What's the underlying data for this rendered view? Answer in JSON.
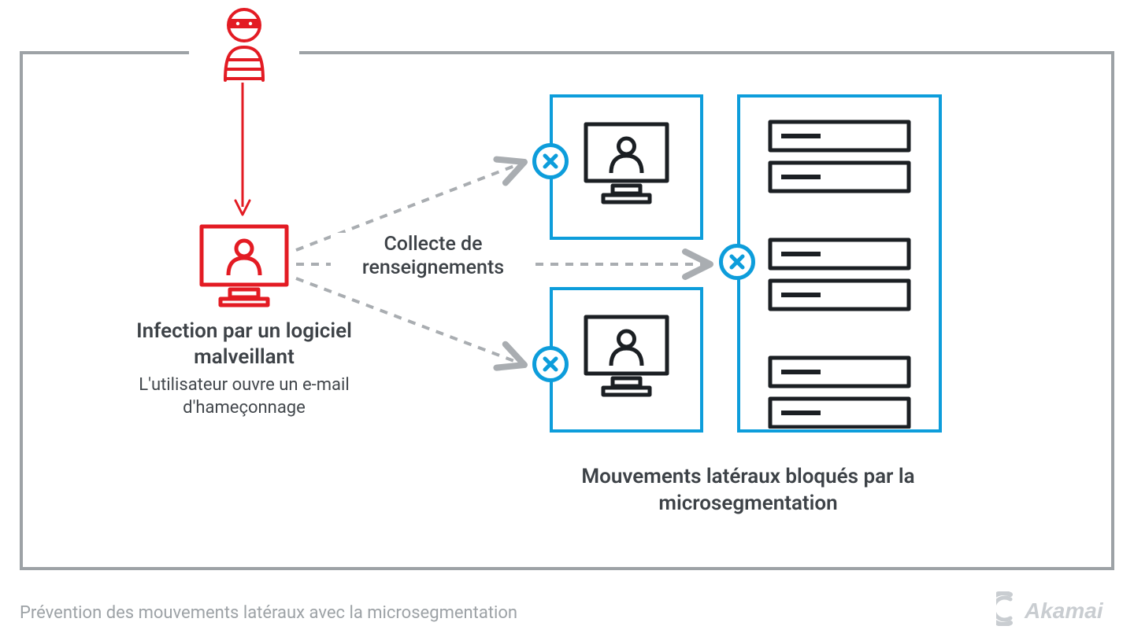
{
  "infection": {
    "title": "Infection par un logiciel malveillant",
    "subtitle": "L'utilisateur ouvre un e-mail d'hameçonnage"
  },
  "collect_label": "Collecte de renseignements",
  "blocked_label": "Mouvements latéraux bloqués par la microsegmentation",
  "caption": "Prévention des mouvements latéraux avec la microsegmentation",
  "logo_text": "Akamai",
  "colors": {
    "frame": "#9da2a6",
    "danger": "#e31b23",
    "accent": "#0d9ddb",
    "ink": "#1b1f23"
  }
}
